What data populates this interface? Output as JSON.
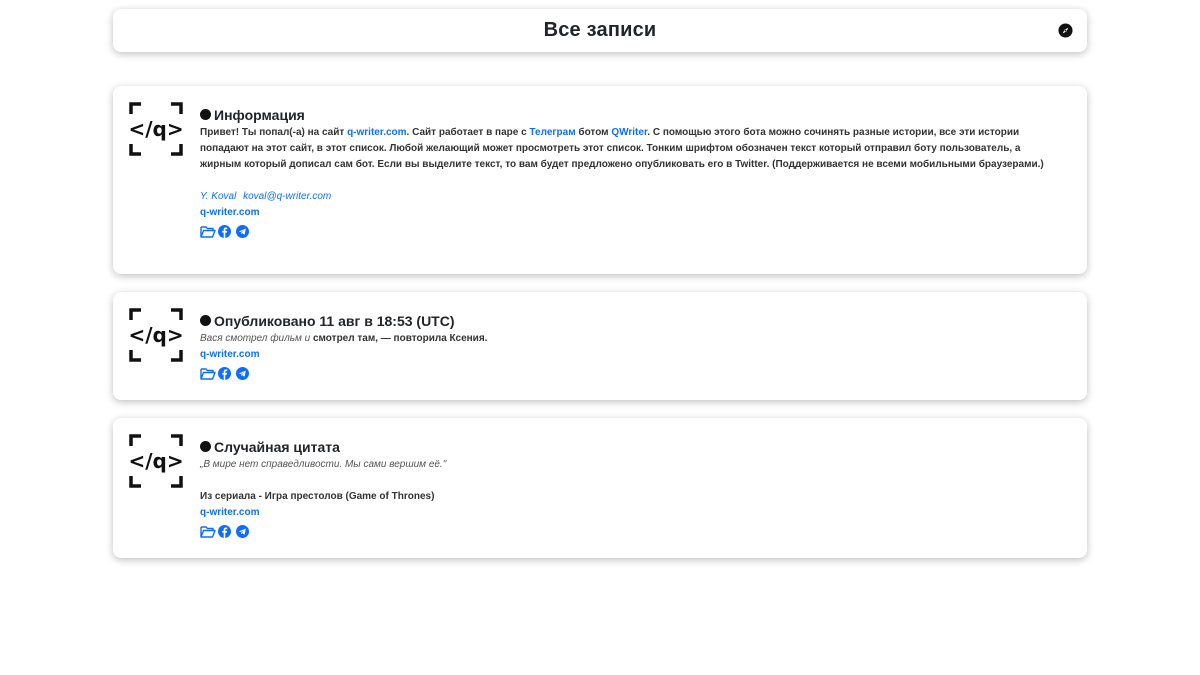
{
  "header": {
    "title": "Все записи",
    "compass_icon": "compass-icon"
  },
  "colors": {
    "link": "#0d6efd",
    "text": "#212529"
  },
  "cards": [
    {
      "title": "Информация",
      "intro_parts": {
        "p1": "Привет! Ты попал(-а) на сайт ",
        "link_site": "q-writer.com",
        "p2": ". Сайт работает в паре с ",
        "link_telegram": "Телеграм",
        "p3": " ботом ",
        "link_bot": "QWriter",
        "p4": ". С помощью этого бота можно сочинять разные истории, все эти истории попадают на этот сайт, в этот список. Любой желающий может просмотреть этот список. Тонким шрифтом обозначен текст который отправил боту пользователь, а жирным который дописал сам бот. Если вы выделите текст, то вам будет предложено опубликовать его в Twitter. (Поддерживается не всеми мобильными браузерами.)"
      },
      "author_name": "Y. Koval",
      "author_email": "koval@q-writer.com",
      "site": "q-writer.com"
    },
    {
      "title": "Опубликовано 11 авг в 18:53 (UTC)",
      "story_user_1": "Вася смотрел фильм и ",
      "story_bot_1": "смотрел там, — повторила Ксения.",
      "site": "q-writer.com"
    },
    {
      "title": "Случайная цитата",
      "quote": "„В мире нет справедливости. Мы сами вершим её.\"",
      "source": "Из сериала - Игра престолов (Game of Thrones)",
      "site": "q-writer.com"
    }
  ],
  "icons": [
    "folder-icon",
    "facebook-icon",
    "telegram-icon"
  ],
  "logo_text": "</q>"
}
